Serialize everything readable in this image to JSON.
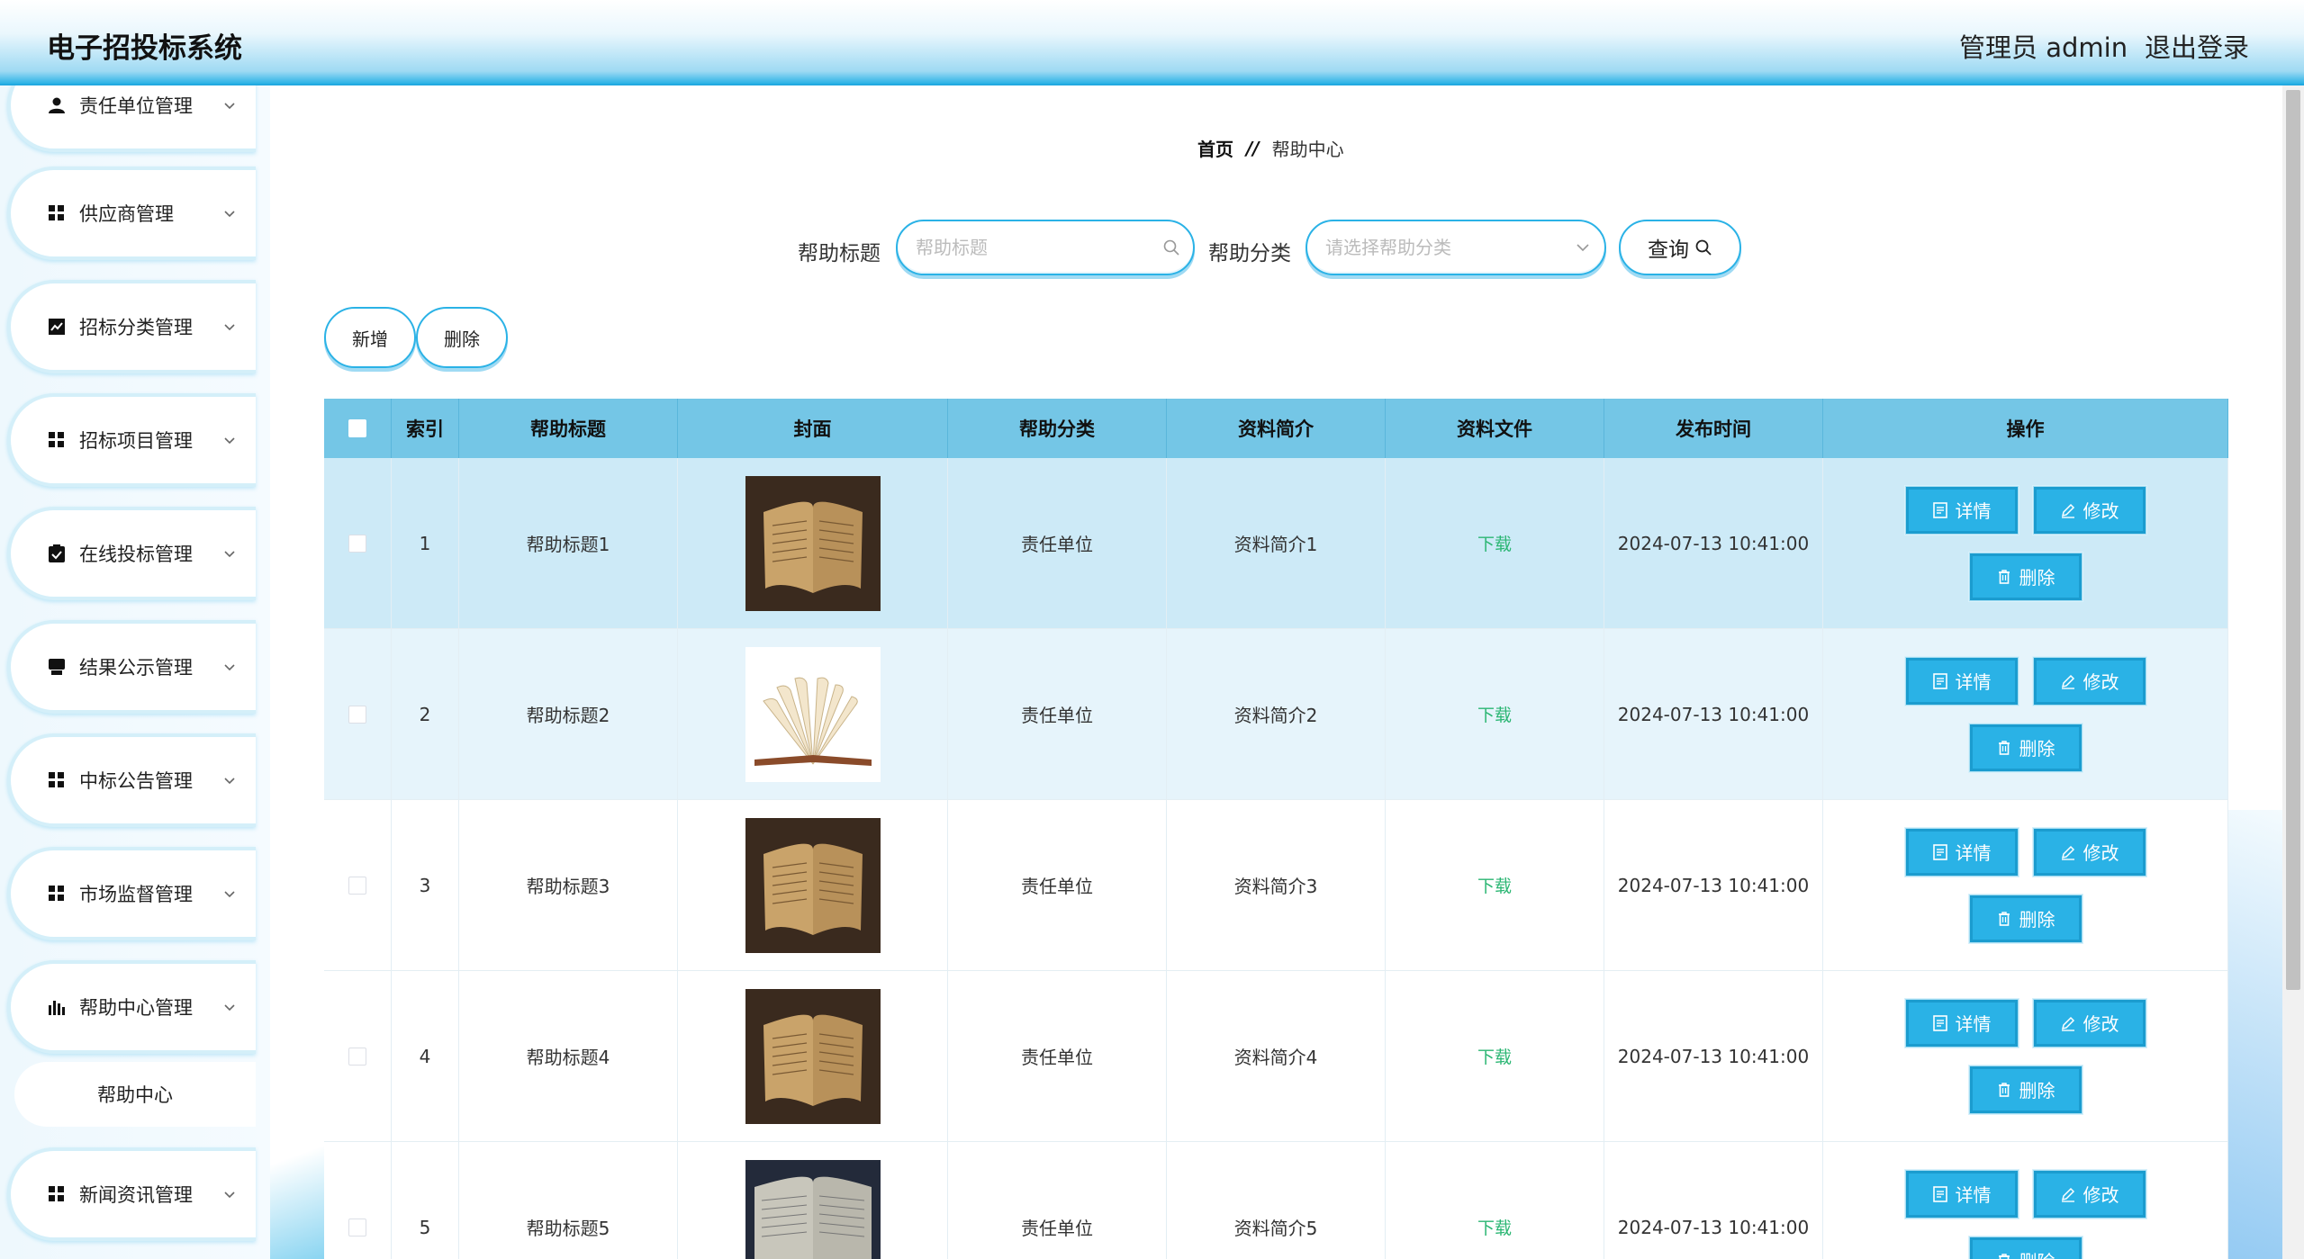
{
  "app": {
    "title": "电子招投标系统",
    "admin_label": "管理员 admin",
    "logout_label": "退出登录"
  },
  "sidebar": {
    "items": [
      {
        "label": "责任单位管理",
        "icon": "user-icon"
      },
      {
        "label": "供应商管理",
        "icon": "grid-icon"
      },
      {
        "label": "招标分类管理",
        "icon": "chart-icon"
      },
      {
        "label": "招标项目管理",
        "icon": "grid-icon"
      },
      {
        "label": "在线投标管理",
        "icon": "clipboard-icon"
      },
      {
        "label": "结果公示管理",
        "icon": "print-icon"
      },
      {
        "label": "中标公告管理",
        "icon": "grid-icon"
      },
      {
        "label": "市场监督管理",
        "icon": "grid-icon"
      },
      {
        "label": "帮助中心管理",
        "icon": "bar-chart-icon"
      },
      {
        "label": "新闻资讯管理",
        "icon": "grid-icon"
      }
    ],
    "sub_item": "帮助中心"
  },
  "breadcrumb": {
    "home": "首页",
    "separator": "//",
    "current": "帮助中心"
  },
  "search": {
    "title_label": "帮助标题",
    "title_placeholder": "帮助标题",
    "title_value": "",
    "category_label": "帮助分类",
    "category_placeholder": "请选择帮助分类",
    "query_label": "查询"
  },
  "toolbar": {
    "add_label": "新增",
    "delete_label": "删除"
  },
  "table": {
    "headers": [
      "索引",
      "帮助标题",
      "封面",
      "帮助分类",
      "资料简介",
      "资料文件",
      "发布时间",
      "操作"
    ],
    "rows": [
      {
        "index": "1",
        "title": "帮助标题1",
        "cover": "old-book",
        "category": "责任单位",
        "intro": "资料简介1",
        "file": "下载",
        "time": "2024-07-13 10:41:00"
      },
      {
        "index": "2",
        "title": "帮助标题2",
        "cover": "fan-book",
        "category": "责任单位",
        "intro": "资料简介2",
        "file": "下载",
        "time": "2024-07-13 10:41:00"
      },
      {
        "index": "3",
        "title": "帮助标题3",
        "cover": "old-book",
        "category": "责任单位",
        "intro": "资料简介3",
        "file": "下载",
        "time": "2024-07-13 10:41:00"
      },
      {
        "index": "4",
        "title": "帮助标题4",
        "cover": "old-book",
        "category": "责任单位",
        "intro": "资料简介4",
        "file": "下载",
        "time": "2024-07-13 10:41:00"
      },
      {
        "index": "5",
        "title": "帮助标题5",
        "cover": "dark-book",
        "category": "责任单位",
        "intro": "资料简介5",
        "file": "下载",
        "time": "2024-07-13 10:41:00"
      }
    ],
    "actions": {
      "detail": "详情",
      "edit": "修改",
      "delete": "删除"
    }
  },
  "colors": {
    "accent": "#2ab2e6",
    "table_header": "#74c6e6",
    "download": "#2bb673"
  }
}
